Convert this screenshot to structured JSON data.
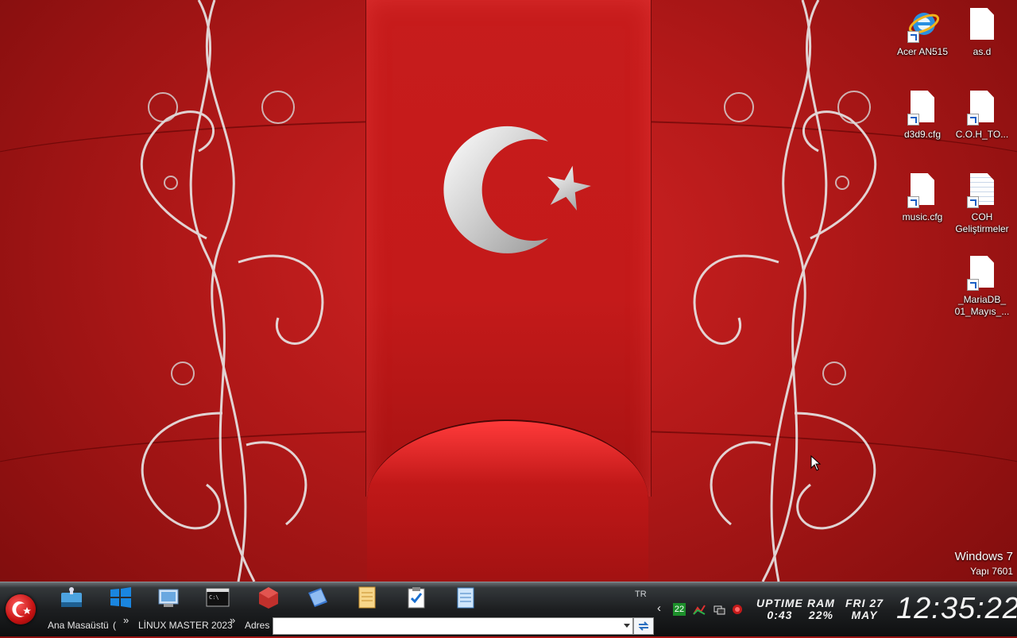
{
  "desktop": {
    "icons": [
      {
        "label": "Acer AN515",
        "icon": "internet-explorer-icon"
      },
      {
        "label": "as.d",
        "icon": "document-icon"
      },
      {
        "label": "d3d9.cfg",
        "icon": "document-shortcut-icon"
      },
      {
        "label": "C.O.H_TO...",
        "icon": "document-shortcut-icon"
      },
      {
        "label": "music.cfg",
        "icon": "document-shortcut-icon"
      },
      {
        "label": "COH Geliştirmeler",
        "icon": "text-document-shortcut-icon"
      },
      {
        "label": "_MariaDB_ 01_Mayıs_...",
        "icon": "document-shortcut-icon"
      }
    ],
    "watermark": {
      "os": "Windows 7",
      "build": "Yapı 7601"
    }
  },
  "taskbar": {
    "quick_launch": [
      "removable-drive-icon",
      "windows-logo-icon",
      "control-panel-icon",
      "command-prompt-icon",
      "package-icon",
      "book-icon",
      "notes-icon",
      "clipboard-check-icon",
      "notepad-icon"
    ],
    "language": "TR",
    "toolbar_desktop": "Ana Masaüstü",
    "toolbar_linux": "LİNUX MASTER 2023",
    "address_label": "Adres",
    "address_value": "",
    "tray": {
      "badge": "22",
      "icons": [
        "green-badge-icon",
        "network-graph-icon",
        "network-icon",
        "antivirus-icon"
      ]
    },
    "uptime_label": "UPTIME",
    "uptime_value": "0:43",
    "ram_label": "RAM",
    "ram_value": "22%",
    "day": "FRI 27",
    "month": "MAY",
    "time": "12:35:22"
  },
  "colors": {
    "wallpaper_red": "#c41a1a",
    "taskbar": "#1d1f21",
    "accent": "#ffffff"
  }
}
